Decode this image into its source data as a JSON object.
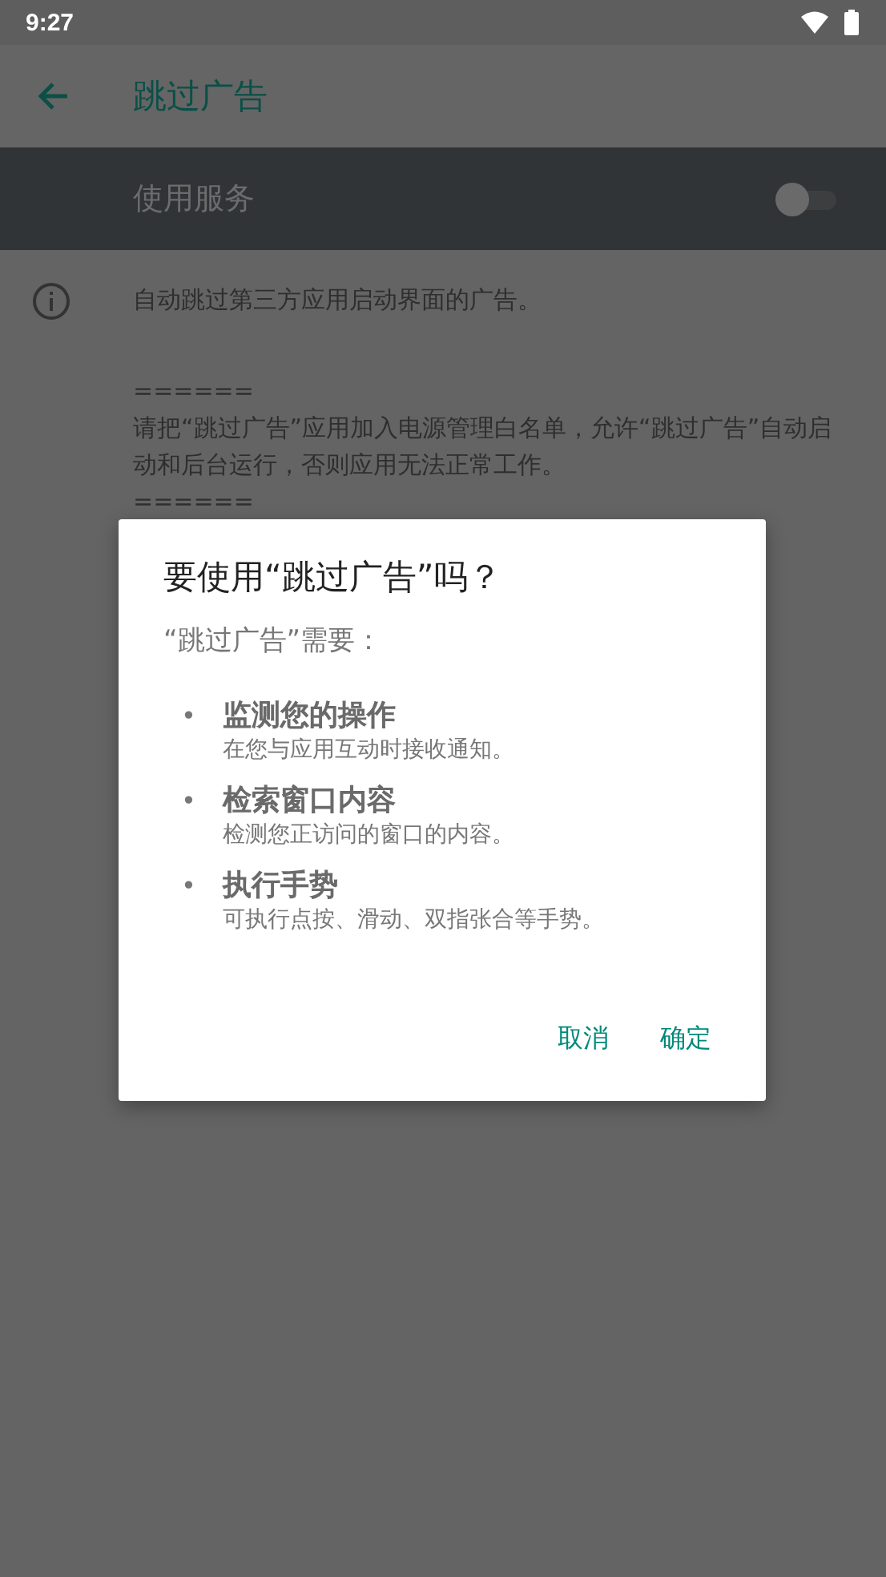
{
  "status_bar": {
    "time": "9:27"
  },
  "app_bar": {
    "title": "跳过广告"
  },
  "service": {
    "label": "使用服务",
    "on": false
  },
  "description": [
    "自动跳过第三方应用启动界面的广告。",
    "======",
    "请把“跳过广告”应用加入电源管理白名单，允许“跳过广告”自动启动和后台运行，否则应用无法正常工作。",
    "======"
  ],
  "dialog": {
    "title": "要使用“跳过广告”吗？",
    "subtitle": "“跳过广告”需要：",
    "permissions": [
      {
        "bullet": "•",
        "title": "监测您的操作",
        "detail": "在您与应用互动时接收通知。"
      },
      {
        "bullet": "•",
        "title": "检索窗口内容",
        "detail": "检测您正访问的窗口的内容。"
      },
      {
        "bullet": "•",
        "title": "执行手势",
        "detail": "可执行点按、滑动、双指张合等手势。"
      }
    ],
    "buttons": [
      "取消",
      "确定"
    ]
  }
}
